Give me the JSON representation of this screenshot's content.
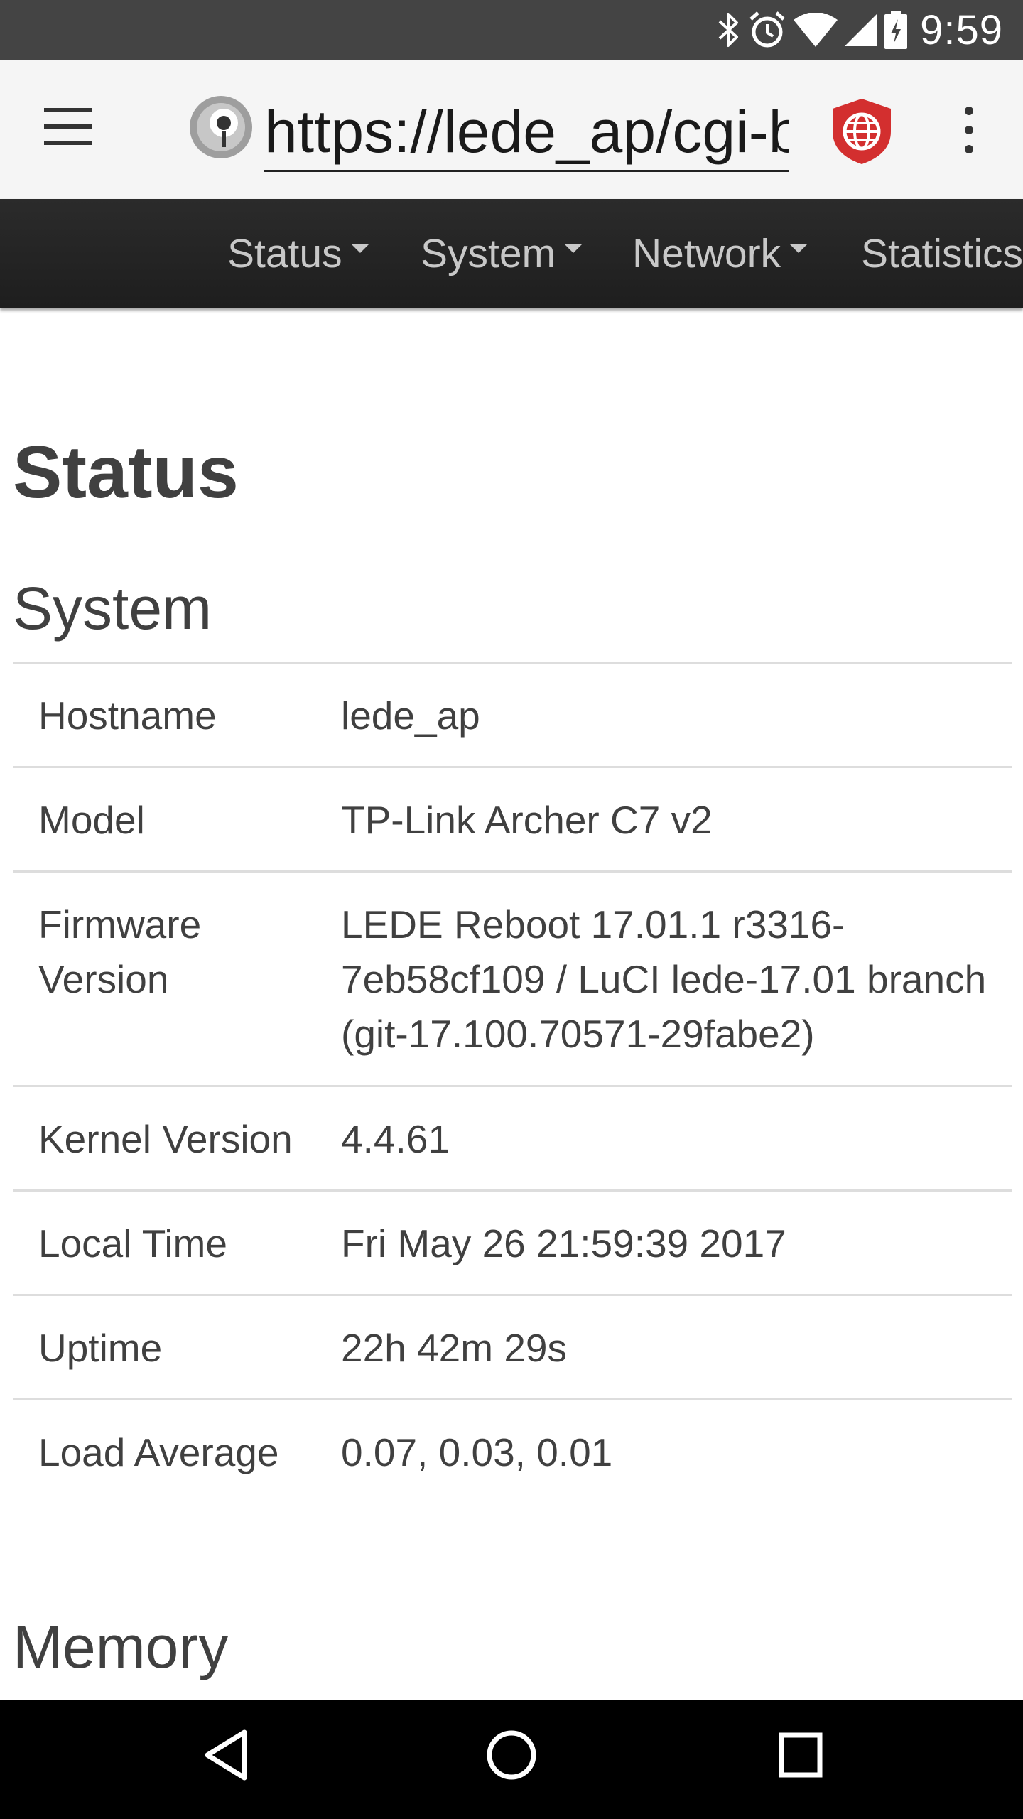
{
  "status_bar": {
    "time": "9:59",
    "icons": [
      "bluetooth-icon",
      "alarm-icon",
      "wifi-icon",
      "signal-icon",
      "battery-charging-icon"
    ]
  },
  "browser": {
    "url": "https://lede_ap/cgi-bin/luci",
    "icons": [
      "menu-icon",
      "site-info-icon",
      "shield-globe-icon",
      "overflow-menu-icon"
    ],
    "shield_color": "#d32f2f"
  },
  "nav": {
    "items": [
      "Status",
      "System",
      "Network",
      "Statistics"
    ]
  },
  "page": {
    "title": "Status"
  },
  "system": {
    "title": "System",
    "rows": [
      {
        "label": "Hostname",
        "value": "lede_ap"
      },
      {
        "label": "Model",
        "value": "TP-Link Archer C7 v2"
      },
      {
        "label": "Firmware Version",
        "value": "LEDE Reboot 17.01.1 r3316-7eb58cf109 / LuCI lede-17.01 branch (git-17.100.70571-29fabe2)"
      },
      {
        "label": "Kernel Version",
        "value": "4.4.61"
      },
      {
        "label": "Local Time",
        "value": "Fri May 26 21:59:39 2017"
      },
      {
        "label": "Uptime",
        "value": "22h 42m 29s"
      },
      {
        "label": "Load Average",
        "value": "0.07, 0.03, 0.01"
      }
    ]
  },
  "memory": {
    "title": "Memory"
  },
  "system_nav": {
    "icons": [
      "back-icon",
      "home-icon",
      "recents-icon"
    ]
  }
}
